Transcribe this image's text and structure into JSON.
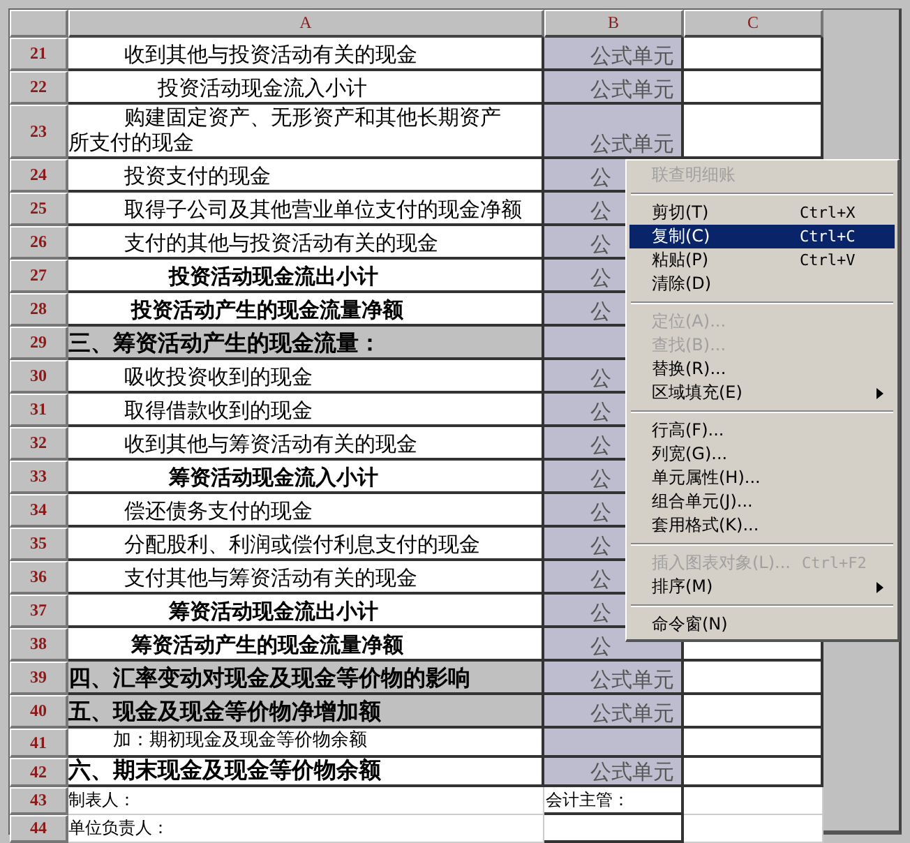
{
  "columns": [
    {
      "label": "A"
    },
    {
      "label": "B"
    },
    {
      "label": "C"
    }
  ],
  "rows": [
    {
      "number": "21",
      "kind": "item",
      "text": "收到其他与投资活动有关的现金",
      "b": "公式单元"
    },
    {
      "number": "22",
      "kind": "sub",
      "text": "投资活动现金流入小计",
      "b": "公式单元"
    },
    {
      "number": "23",
      "kind": "wrap",
      "text": "购建固定资产、无形资产和其他长期资产所支付的现金",
      "b": "公式单元"
    },
    {
      "number": "24",
      "kind": "item",
      "text": "投资支付的现金",
      "b": "公"
    },
    {
      "number": "25",
      "kind": "item",
      "text": "取得子公司及其他营业单位支付的现金净额",
      "b": "公"
    },
    {
      "number": "26",
      "kind": "item",
      "text": "支付的其他与投资活动有关的现金",
      "b": "公"
    },
    {
      "number": "27",
      "kind": "subtotal",
      "text": "投资活动现金流出小计",
      "b": "公"
    },
    {
      "number": "28",
      "kind": "total",
      "text": "投资活动产生的现金流量净额",
      "b": "公"
    },
    {
      "number": "29",
      "kind": "section",
      "text": "三、筹资活动产生的现金流量："
    },
    {
      "number": "30",
      "kind": "item",
      "text": "吸收投资收到的现金",
      "b": "公"
    },
    {
      "number": "31",
      "kind": "item",
      "text": "取得借款收到的现金",
      "b": "公"
    },
    {
      "number": "32",
      "kind": "item",
      "text": "收到其他与筹资活动有关的现金",
      "b": "公"
    },
    {
      "number": "33",
      "kind": "subtotal",
      "text": "筹资活动现金流入小计",
      "b": "公"
    },
    {
      "number": "34",
      "kind": "item",
      "text": "偿还债务支付的现金",
      "b": "公"
    },
    {
      "number": "35",
      "kind": "item",
      "text": "分配股利、利润或偿付利息支付的现金",
      "b": "公"
    },
    {
      "number": "36",
      "kind": "item",
      "text": "支付其他与筹资活动有关的现金",
      "b": "公"
    },
    {
      "number": "37",
      "kind": "subtotal",
      "text": "筹资活动现金流出小计",
      "b": "公"
    },
    {
      "number": "38",
      "kind": "total",
      "text": "筹资活动产生的现金流量净额",
      "b": "公"
    },
    {
      "number": "39",
      "kind": "section",
      "text": "四、汇率变动对现金及现金等价物的影响",
      "b": "公式单元"
    },
    {
      "number": "40",
      "kind": "section",
      "text": "五、现金及现金等价物净增加额",
      "b": "公式单元"
    },
    {
      "number": "41",
      "kind": "note",
      "text": "加：期初现金及现金等价物余额"
    },
    {
      "number": "42",
      "kind": "heading",
      "text": "六、期末现金及现金等价物余额",
      "b": "公式单元"
    },
    {
      "number": "43",
      "kind": "footer",
      "text": "制表人：",
      "b": "会计主管："
    },
    {
      "number": "44",
      "kind": "footer",
      "text": "单位负责人："
    }
  ],
  "context_menu": {
    "items": [
      {
        "kind": "item",
        "label": "联查明细账",
        "disabled": true,
        "selected": false,
        "submenu": false
      },
      {
        "kind": "separator"
      },
      {
        "kind": "item",
        "label": "剪切(T)",
        "shortcut": "Ctrl+X",
        "disabled": false,
        "selected": false,
        "submenu": false
      },
      {
        "kind": "item",
        "label": "复制(C)",
        "shortcut": "Ctrl+C",
        "disabled": false,
        "selected": true,
        "submenu": false
      },
      {
        "kind": "item",
        "label": "粘贴(P)",
        "shortcut": "Ctrl+V",
        "disabled": false,
        "selected": false,
        "submenu": false
      },
      {
        "kind": "item",
        "label": "清除(D)",
        "disabled": false,
        "selected": false,
        "submenu": false
      },
      {
        "kind": "separator"
      },
      {
        "kind": "item",
        "label": "定位(A)...",
        "disabled": true,
        "selected": false,
        "submenu": false
      },
      {
        "kind": "item",
        "label": "查找(B)...",
        "disabled": true,
        "selected": false,
        "submenu": false
      },
      {
        "kind": "item",
        "label": "替换(R)...",
        "disabled": false,
        "selected": false,
        "submenu": false
      },
      {
        "kind": "item",
        "label": "区域填充(E)",
        "disabled": false,
        "selected": false,
        "submenu": true
      },
      {
        "kind": "separator"
      },
      {
        "kind": "item",
        "label": "行高(F)...",
        "disabled": false,
        "selected": false,
        "submenu": false
      },
      {
        "kind": "item",
        "label": "列宽(G)...",
        "disabled": false,
        "selected": false,
        "submenu": false
      },
      {
        "kind": "item",
        "label": "单元属性(H)...",
        "disabled": false,
        "selected": false,
        "submenu": false
      },
      {
        "kind": "item",
        "label": "组合单元(J)...",
        "disabled": false,
        "selected": false,
        "submenu": false
      },
      {
        "kind": "item",
        "label": "套用格式(K)...",
        "disabled": false,
        "selected": false,
        "submenu": false
      },
      {
        "kind": "separator"
      },
      {
        "kind": "item",
        "label": "插入图表对象(L)...",
        "shortcut": "Ctrl+F2",
        "disabled": true,
        "selected": false,
        "submenu": false
      },
      {
        "kind": "item",
        "label": "排序(M)",
        "disabled": false,
        "selected": false,
        "submenu": true
      },
      {
        "kind": "separator"
      },
      {
        "kind": "item",
        "label": "命令窗(N)",
        "disabled": false,
        "selected": false,
        "submenu": false
      }
    ]
  }
}
